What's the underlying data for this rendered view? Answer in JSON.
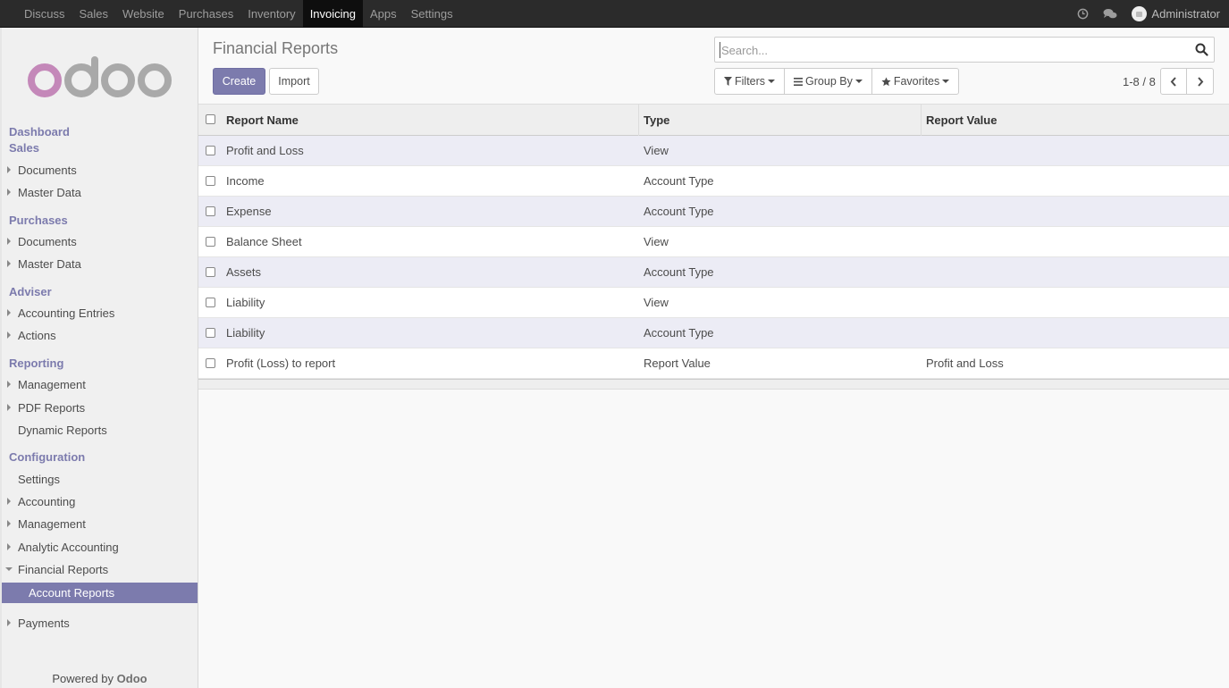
{
  "topbar": {
    "menu": [
      "Discuss",
      "Sales",
      "Website",
      "Purchases",
      "Inventory",
      "Invoicing",
      "Apps",
      "Settings"
    ],
    "active": "Invoicing",
    "user": "Administrator"
  },
  "sidebar": {
    "dashboard": "Dashboard",
    "sales": "Sales",
    "sales_documents": "Documents",
    "sales_master_data": "Master Data",
    "purchases": "Purchases",
    "purchases_documents": "Documents",
    "purchases_master_data": "Master Data",
    "adviser": "Adviser",
    "accounting_entries": "Accounting Entries",
    "actions": "Actions",
    "reporting": "Reporting",
    "management": "Management",
    "pdf_reports": "PDF Reports",
    "dynamic_reports": "Dynamic Reports",
    "configuration": "Configuration",
    "settings": "Settings",
    "accounting": "Accounting",
    "config_management": "Management",
    "analytic_accounting": "Analytic Accounting",
    "financial_reports": "Financial Reports",
    "account_reports": "Account Reports",
    "payments": "Payments",
    "powered_by": "Powered by",
    "powered_brand": "Odoo"
  },
  "control": {
    "title": "Financial Reports",
    "create": "Create",
    "import": "Import",
    "search_placeholder": "Search...",
    "filters": "Filters",
    "group_by": "Group By",
    "favorites": "Favorites",
    "pager": "1-8 / 8"
  },
  "table": {
    "headers": [
      "Report Name",
      "Type",
      "Report Value"
    ],
    "rows": [
      {
        "name": "Profit and Loss",
        "type": "View",
        "value": ""
      },
      {
        "name": "Income",
        "type": "Account Type",
        "value": ""
      },
      {
        "name": "Expense",
        "type": "Account Type",
        "value": ""
      },
      {
        "name": "Balance Sheet",
        "type": "View",
        "value": ""
      },
      {
        "name": "Assets",
        "type": "Account Type",
        "value": ""
      },
      {
        "name": "Liability",
        "type": "View",
        "value": ""
      },
      {
        "name": "Liability",
        "type": "Account Type",
        "value": ""
      },
      {
        "name": "Profit (Loss) to report",
        "type": "Report Value",
        "value": "Profit and Loss"
      }
    ]
  },
  "colors": {
    "brand": "#7c7bad",
    "topbar": "#2b2b2b",
    "logo_o": "#c488b9",
    "logo_rest": "#a9a9a9"
  }
}
